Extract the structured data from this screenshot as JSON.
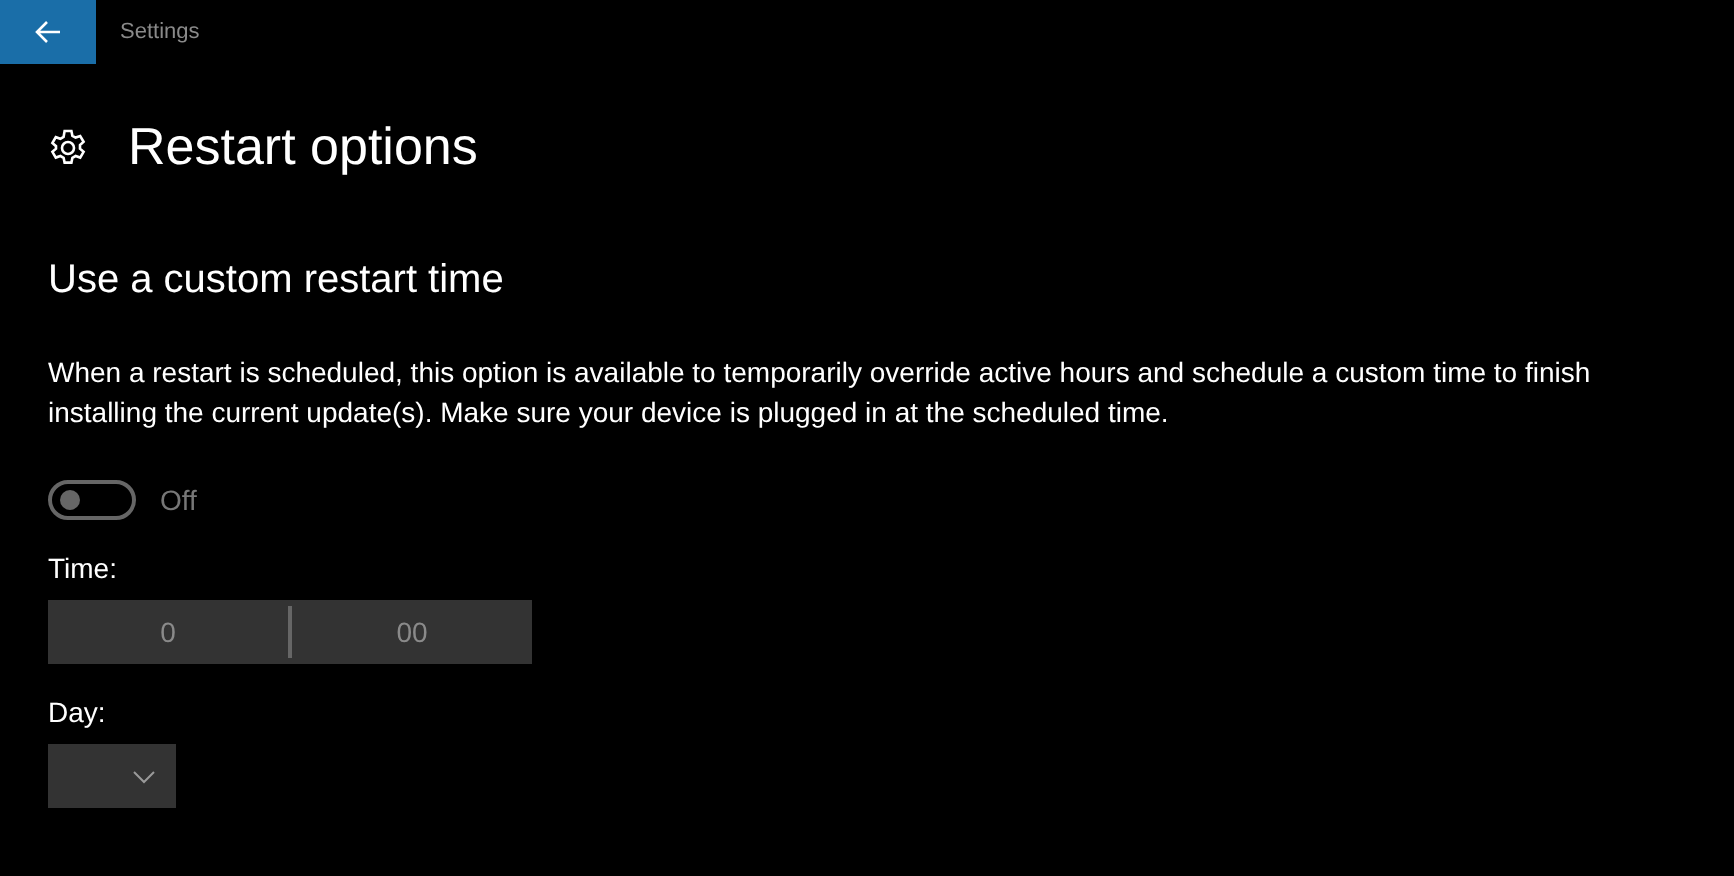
{
  "window": {
    "title": "Settings"
  },
  "page": {
    "title": "Restart options"
  },
  "section": {
    "heading": "Use a custom restart time",
    "description": "When a restart is scheduled, this option is available to temporarily override active hours and schedule a custom time to finish installing the current update(s). Make sure your device is plugged in at the scheduled time."
  },
  "toggle": {
    "on": false,
    "disabled": true,
    "label": "Off"
  },
  "time": {
    "label": "Time:",
    "hour": "0",
    "minute": "00",
    "disabled": true
  },
  "day": {
    "label": "Day:",
    "disabled": true
  }
}
